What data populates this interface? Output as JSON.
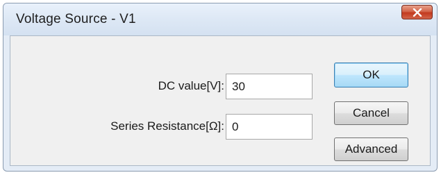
{
  "window": {
    "title": "Voltage Source - V1"
  },
  "form": {
    "dc_label": "DC value[V]:",
    "dc_value": "30",
    "resistance_label": "Series Resistance[Ω]:",
    "resistance_value": "0"
  },
  "buttons": {
    "ok": "OK",
    "cancel": "Cancel",
    "advanced": "Advanced"
  },
  "icons": {
    "close": "close-icon"
  },
  "colors": {
    "close_button": "#c2391e",
    "default_button_border": "#3c7fb1",
    "title_bar": "#dde8f5",
    "client_background": "#f0f0f0"
  }
}
